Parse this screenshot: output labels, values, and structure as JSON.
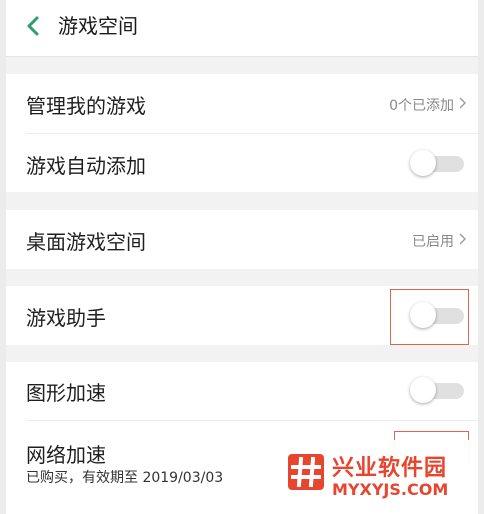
{
  "header": {
    "title": "游戏空间",
    "back_icon": "chevron-left-icon"
  },
  "sections": {
    "manage": {
      "my_games_label": "管理我的游戏",
      "my_games_value": "0个已添加",
      "auto_add_label": "游戏自动添加",
      "auto_add_on": false
    },
    "desktop": {
      "label": "桌面游戏空间",
      "value": "已启用"
    },
    "assistant": {
      "label": "游戏助手",
      "on": false
    },
    "acceleration": {
      "graphics_label": "图形加速",
      "graphics_on": false,
      "network_label": "网络加速",
      "network_subtext": "已购买，有效期至 2019/03/03"
    }
  },
  "watermark": {
    "title": "兴业软件园",
    "subtitle": "MYXYJS.COM",
    "icon": "hash-logo-icon"
  },
  "colors": {
    "accent_green": "#2e9e6a",
    "highlight_border": "#d66a4a",
    "watermark_red": "#e8452f"
  }
}
